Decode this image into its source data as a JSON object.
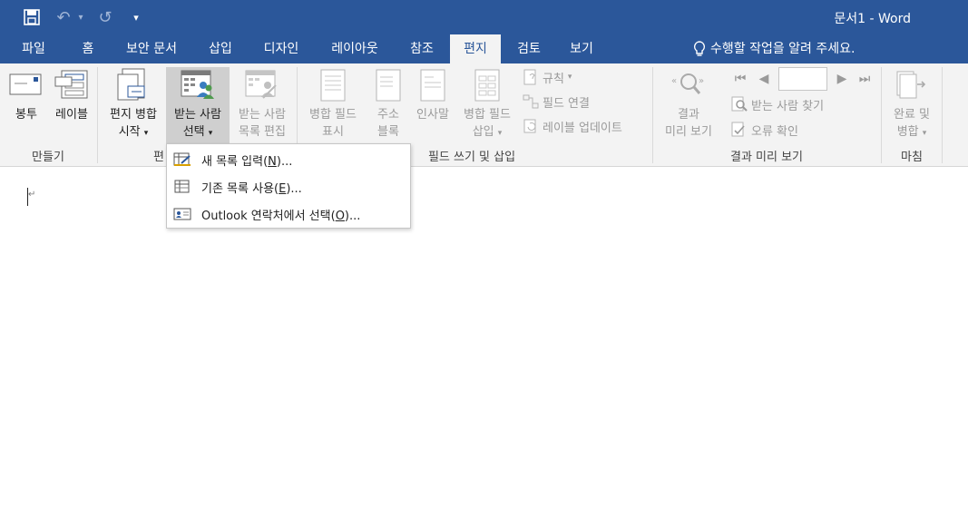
{
  "window": {
    "title": "문서1 - Word"
  },
  "quick_access": {
    "undo_glyph": "↶",
    "redo_glyph": "↺",
    "customize_glyph": "▾",
    "dropdown_glyph": "▾"
  },
  "tabs": [
    {
      "label": "파일"
    },
    {
      "label": "홈"
    },
    {
      "label": "보안 문서"
    },
    {
      "label": "삽입"
    },
    {
      "label": "디자인"
    },
    {
      "label": "레이아웃"
    },
    {
      "label": "참조"
    },
    {
      "label": "편지",
      "active": true
    },
    {
      "label": "검토"
    },
    {
      "label": "보기"
    }
  ],
  "tell_me": {
    "text": "수행할 작업을 알려 주세요."
  },
  "ribbon": {
    "groups": {
      "create": "만들기",
      "start": "편",
      "write_insert": "필드 쓰기 및 삽입",
      "preview": "결과 미리 보기",
      "finish": "마침"
    },
    "envelope": "봉투",
    "label": "레이블",
    "start_merge": {
      "line1": "편지 병합",
      "line2": "시작"
    },
    "select_recipients": {
      "line1": "받는 사람",
      "line2": "선택"
    },
    "edit_recipients": {
      "line1": "받는 사람",
      "line2": "목록 편집"
    },
    "highlight_fields": {
      "line1": "병합 필드",
      "line2": "표시"
    },
    "address_block": {
      "line1": "주소",
      "line2": "블록"
    },
    "greeting_line": {
      "line1": "인사말"
    },
    "insert_merge_field": {
      "line1": "병합 필드",
      "line2": "삽입"
    },
    "rules": "규칙",
    "match_fields": "필드 연결",
    "update_labels": "레이블 업데이트",
    "preview_results": {
      "line1": "결과",
      "line2": "미리 보기"
    },
    "find_recipient": "받는 사람 찾기",
    "check_errors": "오류 확인",
    "finish_merge": {
      "line1": "완료 및",
      "line2": "병합"
    },
    "nav": {
      "first": "⏮",
      "prev": "◀",
      "next": "▶",
      "last": "⏭"
    }
  },
  "dropdown": {
    "items": [
      {
        "text": "새 목록 입력(",
        "key": "N",
        "suffix": ")..."
      },
      {
        "text": "기존 목록 사용(",
        "key": "E",
        "suffix": ")..."
      },
      {
        "text": "Outlook 연락처에서 선택(",
        "key": "O",
        "suffix": ")..."
      }
    ]
  },
  "document": {
    "paragraph_mark": "↵"
  },
  "colors": {
    "brand": "#2b579a",
    "ribbon": "#f3f3f3",
    "disabled": "#9a9a9a"
  }
}
